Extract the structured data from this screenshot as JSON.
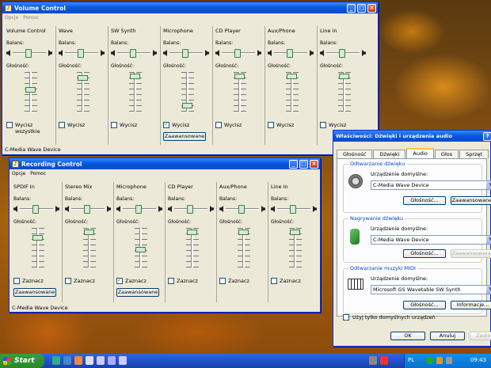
{
  "volume_control": {
    "title": "Volume Control",
    "menu": [
      "Opcje",
      "Pomoc"
    ],
    "balance_label": "Balans:",
    "volume_label": "Głośność:",
    "advanced_label": "Zaawansowane",
    "status": "C-Media Wave Device",
    "columns": [
      {
        "name": "Volume Control",
        "mute_label": "Wycisz wszystkie",
        "muted": false,
        "level": 0.55
      },
      {
        "name": "Wave",
        "mute_label": "Wycisz",
        "muted": false,
        "level": 0.9
      },
      {
        "name": "SW Synth",
        "mute_label": "Wycisz",
        "muted": false,
        "level": 0.95
      },
      {
        "name": "Microphone",
        "mute_label": "Wycisz",
        "muted": true,
        "level": 0.1
      },
      {
        "name": "CD Player",
        "mute_label": "Wycisz",
        "muted": false,
        "level": 0.95
      },
      {
        "name": "Aux/Phone",
        "mute_label": "Wycisz",
        "muted": false,
        "level": 0.95
      },
      {
        "name": "Line In",
        "mute_label": "Wycisz",
        "muted": false,
        "level": 0.95
      }
    ]
  },
  "recording_control": {
    "title": "Recording Control",
    "menu": [
      "Opcje",
      "Pomoc"
    ],
    "balance_label": "Balans:",
    "volume_label": "Głośność:",
    "advanced_label": "Zaawansowane",
    "status": "C-Media Wave Device",
    "columns": [
      {
        "name": "SPDIF In",
        "mute_label": "Zaznacz",
        "muted": false,
        "level": 0.8,
        "advanced": true
      },
      {
        "name": "Stereo Mix",
        "mute_label": "Zaznacz",
        "muted": false,
        "level": 0.95,
        "advanced": false
      },
      {
        "name": "Microphone",
        "mute_label": "Zaznacz",
        "muted": true,
        "level": 0.45,
        "advanced": true
      },
      {
        "name": "CD Player",
        "mute_label": "Zaznacz",
        "muted": false,
        "level": 0.95,
        "advanced": false
      },
      {
        "name": "Aux/Phone",
        "mute_label": "Zaznacz",
        "muted": false,
        "level": 0.95,
        "advanced": false
      },
      {
        "name": "Line In",
        "mute_label": "Zaznacz",
        "muted": false,
        "level": 0.95,
        "advanced": false
      }
    ]
  },
  "properties": {
    "title": "Właściwości: Dźwięki i urządzenia audio",
    "tabs": [
      "Głośność",
      "Dźwięki",
      "Audio",
      "Głos",
      "Sprzęt"
    ],
    "selected_tab": "Audio",
    "playback": {
      "group_title": "Odtwarzanie dźwięku",
      "default_label": "Urządzenie domyślne:",
      "device": "C-Media Wave Device",
      "volume_btn": "Głośność...",
      "advanced_btn": "Zaawansowane..."
    },
    "recording": {
      "group_title": "Nagrywanie dźwięku",
      "default_label": "Urządzenie domyślne:",
      "device": "C-Media Wave Device",
      "volume_btn": "Głośność...",
      "advanced_btn": "Zaawansowane..."
    },
    "midi": {
      "group_title": "Odtwarzanie muzyki MIDI",
      "default_label": "Urządzenie domyślne:",
      "device": "Microsoft GS Wavetable SW Synth",
      "volume_btn": "Głośność...",
      "info_btn": "Informacje..."
    },
    "only_default_label": "Użyj tylko domyślnych urządzeń",
    "ok": "OK",
    "cancel": "Anuluj",
    "apply": "Zastosuj"
  },
  "taskbar": {
    "start": "Start",
    "lang": "PL",
    "clock": "09:43"
  }
}
